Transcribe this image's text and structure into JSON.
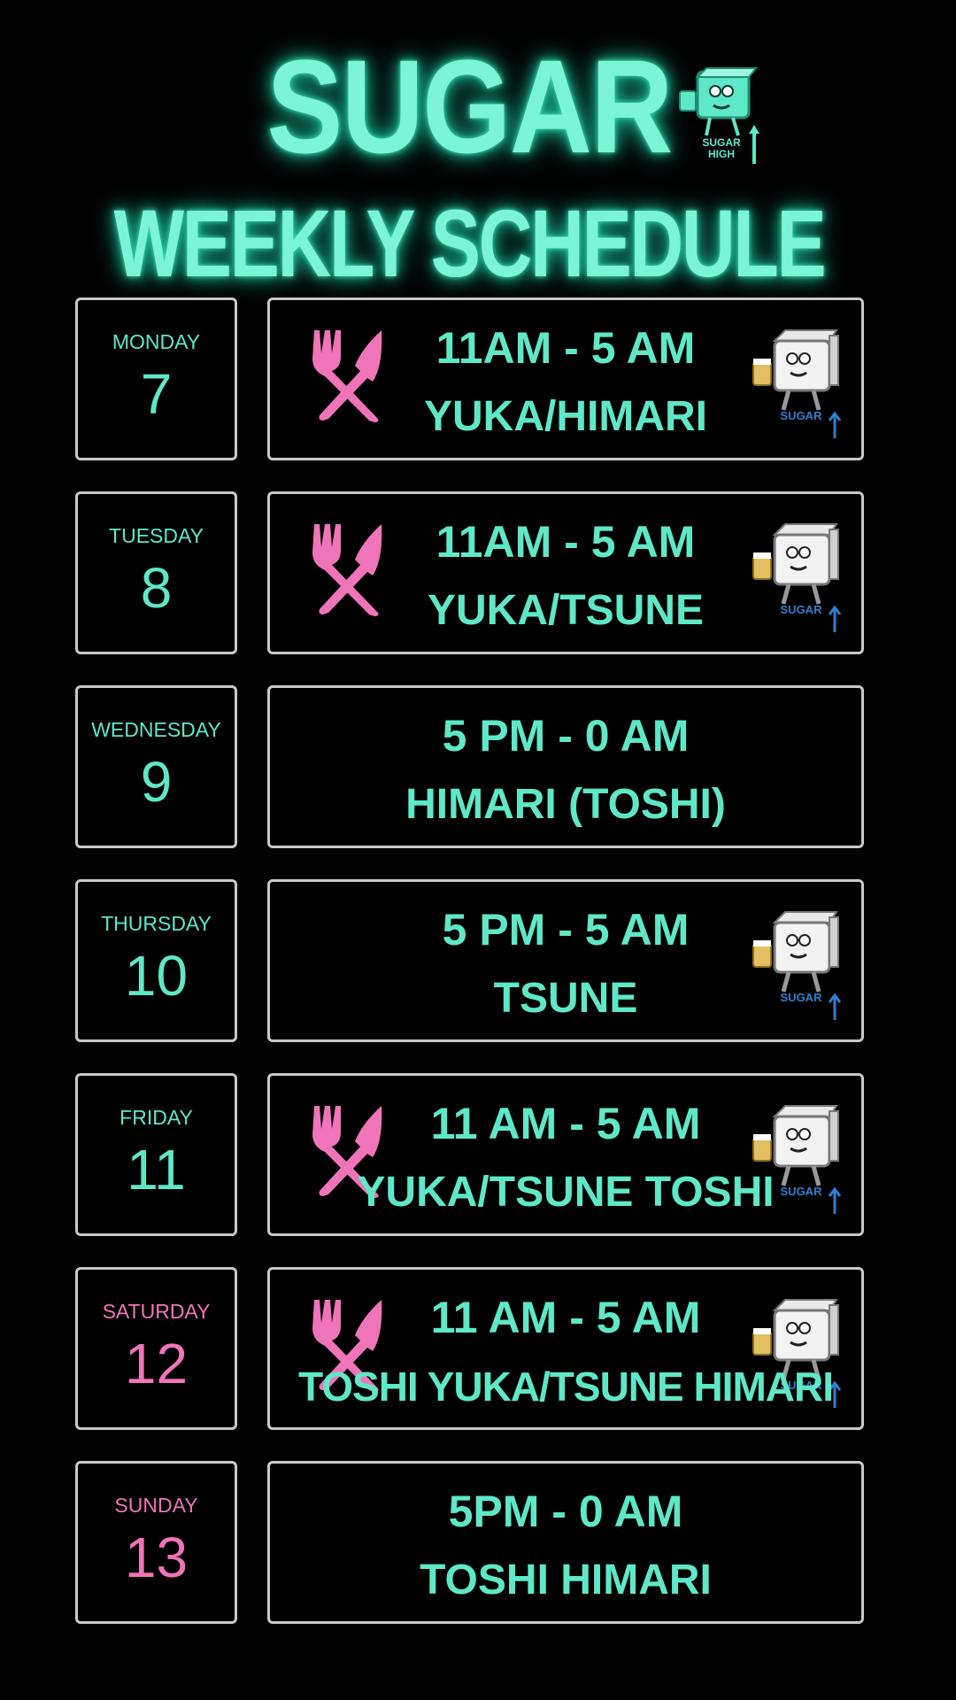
{
  "header": {
    "title": "SUGAR",
    "subtitle": "WEEKLY SCHEDULE",
    "logo": {
      "icon": "sugar-cube-mascot-icon",
      "text": "SUGAR HIGH"
    }
  },
  "mascot_brand": "SUGAR",
  "colors": {
    "accent": "#5ee8c8",
    "pink": "#f074b9",
    "border": "#c9c9c9",
    "background": "#000000"
  },
  "schedule": [
    {
      "day": "MONDAY",
      "date": "7",
      "time": "11AM - 5 AM",
      "staff": "YUKA/HIMARI",
      "food_icon": "fork-knife-icon",
      "mascot_icon": "sugar-cube-mascot-icon",
      "day_color": "accent"
    },
    {
      "day": "TUESDAY",
      "date": "8",
      "time": "11AM - 5 AM",
      "staff": "YUKA/TSUNE",
      "food_icon": "fork-knife-icon",
      "mascot_icon": "sugar-cube-mascot-icon",
      "day_color": "accent"
    },
    {
      "day": "WEDNESDAY",
      "date": "9",
      "time": "5 PM - 0 AM",
      "staff": "HIMARI (TOSHI)",
      "food_icon": null,
      "mascot_icon": null,
      "day_color": "accent"
    },
    {
      "day": "THURSDAY",
      "date": "10",
      "time": "5 PM - 5 AM",
      "staff": "TSUNE",
      "food_icon": null,
      "mascot_icon": "sugar-cube-mascot-icon",
      "day_color": "accent"
    },
    {
      "day": "FRIDAY",
      "date": "11",
      "time": "11 AM - 5 AM",
      "staff": "YUKA/TSUNE TOSHI",
      "food_icon": "fork-knife-icon",
      "mascot_icon": "sugar-cube-mascot-icon",
      "day_color": "accent"
    },
    {
      "day": "SATURDAY",
      "date": "12",
      "time": "11 AM - 5 AM",
      "staff": "TOSHI YUKA/TSUNE HIMARI",
      "food_icon": "fork-knife-icon",
      "mascot_icon": "sugar-cube-mascot-icon",
      "day_color": "pink"
    },
    {
      "day": "SUNDAY",
      "date": "13",
      "time": "5PM - 0 AM",
      "staff": "TOSHI HIMARI",
      "food_icon": null,
      "mascot_icon": null,
      "day_color": "pink"
    }
  ]
}
